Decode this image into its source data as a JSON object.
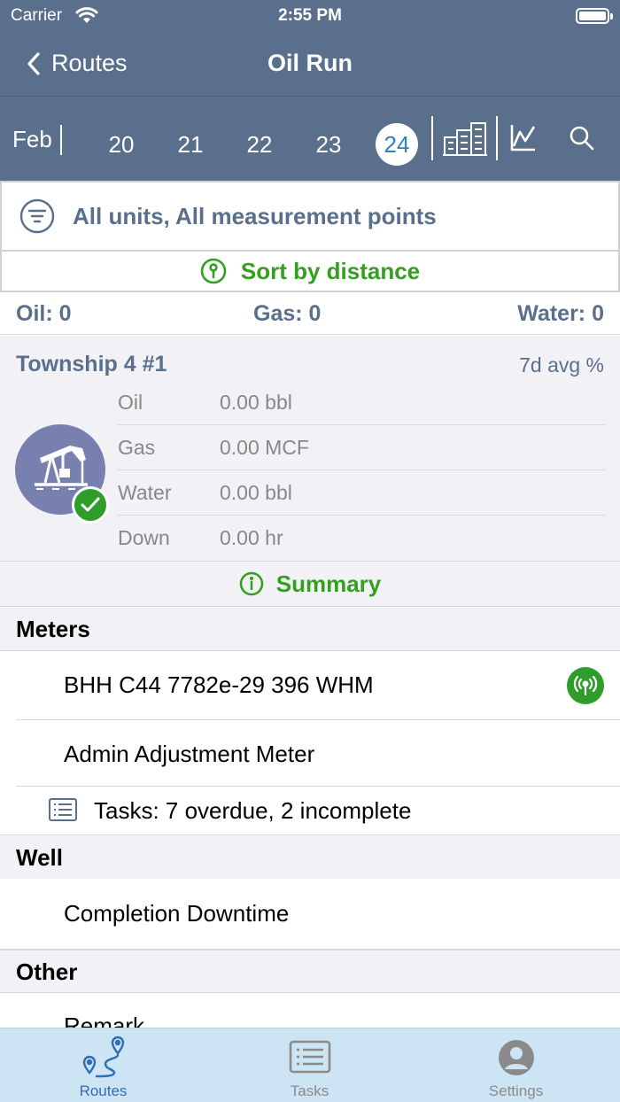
{
  "status_bar": {
    "carrier": "Carrier",
    "time": "2:55 PM"
  },
  "nav": {
    "back_label": "Routes",
    "title": "Oil Run"
  },
  "date_strip": {
    "month": "Feb",
    "days": [
      "20",
      "21",
      "22",
      "23",
      "24"
    ],
    "selected_day": "24"
  },
  "filter": {
    "label": "All units, All measurement points"
  },
  "sort": {
    "label": "Sort by distance"
  },
  "totals": {
    "oil": "Oil: 0",
    "gas": "Gas: 0",
    "water": "Water: 0"
  },
  "well": {
    "name": "Township 4 #1",
    "avg_label": "7d avg %",
    "metrics": [
      {
        "label": "Oil",
        "value": "0.00 bbl"
      },
      {
        "label": "Gas",
        "value": "0.00 MCF"
      },
      {
        "label": "Water",
        "value": "0.00 bbl"
      },
      {
        "label": "Down",
        "value": "0.00 hr"
      }
    ]
  },
  "summary": {
    "label": "Summary"
  },
  "sections": {
    "meters": {
      "title": "Meters",
      "items": [
        "BHH C44 7782e-29 396 WHM",
        "Admin Adjustment Meter"
      ],
      "tasks": "Tasks: 7 overdue, 2 incomplete"
    },
    "well": {
      "title": "Well",
      "items": [
        "Completion Downtime"
      ]
    },
    "other": {
      "title": "Other",
      "items": [
        "Remark"
      ]
    }
  },
  "tabs": [
    {
      "label": "Routes",
      "color": "#2f6db5"
    },
    {
      "label": "Tasks",
      "color": "#8a8a8a"
    },
    {
      "label": "Settings",
      "color": "#8a8a8a"
    }
  ],
  "colors": {
    "header": "#5a6f8c",
    "accent_green": "#34a020",
    "selected_day": "#2f80c5",
    "tab_bar": "#cde4f4"
  }
}
